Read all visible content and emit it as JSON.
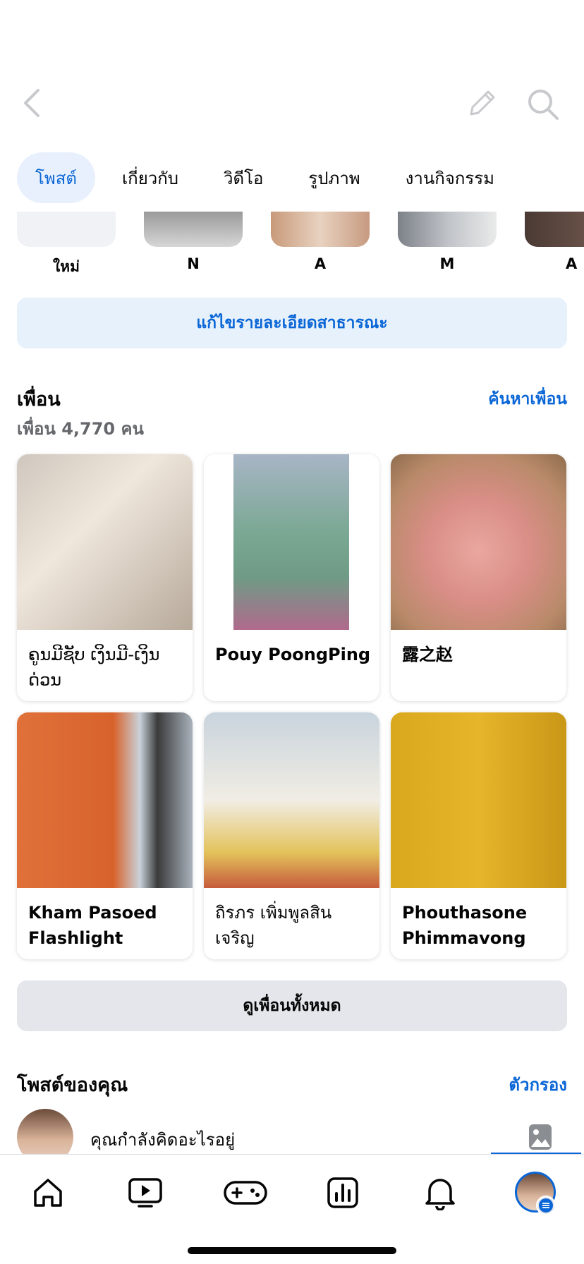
{
  "tabs": [
    {
      "label": "โพสต์",
      "active": true
    },
    {
      "label": "เกี่ยวกับ",
      "active": false
    },
    {
      "label": "วิดีโอ",
      "active": false
    },
    {
      "label": "รูปภาพ",
      "active": false
    },
    {
      "label": "งานกิจกรรม",
      "active": false
    }
  ],
  "stories": [
    {
      "label": "ใหม่"
    },
    {
      "label": "N"
    },
    {
      "label": "A"
    },
    {
      "label": "M"
    },
    {
      "label": "A"
    }
  ],
  "edit_public_details": "แก้ไขรายละเอียดสาธารณะ",
  "friends": {
    "title": "เพื่อน",
    "count": "เพื่อน 4,770 คน",
    "find_link": "ค้นหาเพื่อน",
    "cards": [
      {
        "name": "ຄູນມີຊັບ ເງິນມີ-ເງິນ ດ່ວນ"
      },
      {
        "name": "Pouy PoongPing"
      },
      {
        "name": "露之赵"
      },
      {
        "name": "Kham Pasoed Flashlight"
      },
      {
        "name": "ถิรภร เพิ่มพูลสิน เจริญ"
      },
      {
        "name": "Phouthasone Phimmavong"
      }
    ],
    "see_all": "ดูเพื่อนทั้งหมด"
  },
  "posts": {
    "title": "โพสต์ของคุณ",
    "filter_link": "ตัวกรอง",
    "composer_placeholder": "คุณกำลังคิดอะไรอยู่"
  },
  "colors": {
    "accent": "#0a66d6",
    "tab_active_bg": "#e7f0fc",
    "button_gray": "#e4e6eb"
  },
  "icons": {
    "back": "chevron-left-icon",
    "edit": "pencil-icon",
    "search": "search-icon",
    "nav": [
      "home-icon",
      "video-icon",
      "gaming-icon",
      "dashboard-icon",
      "bell-icon",
      "profile-menu-icon"
    ]
  }
}
